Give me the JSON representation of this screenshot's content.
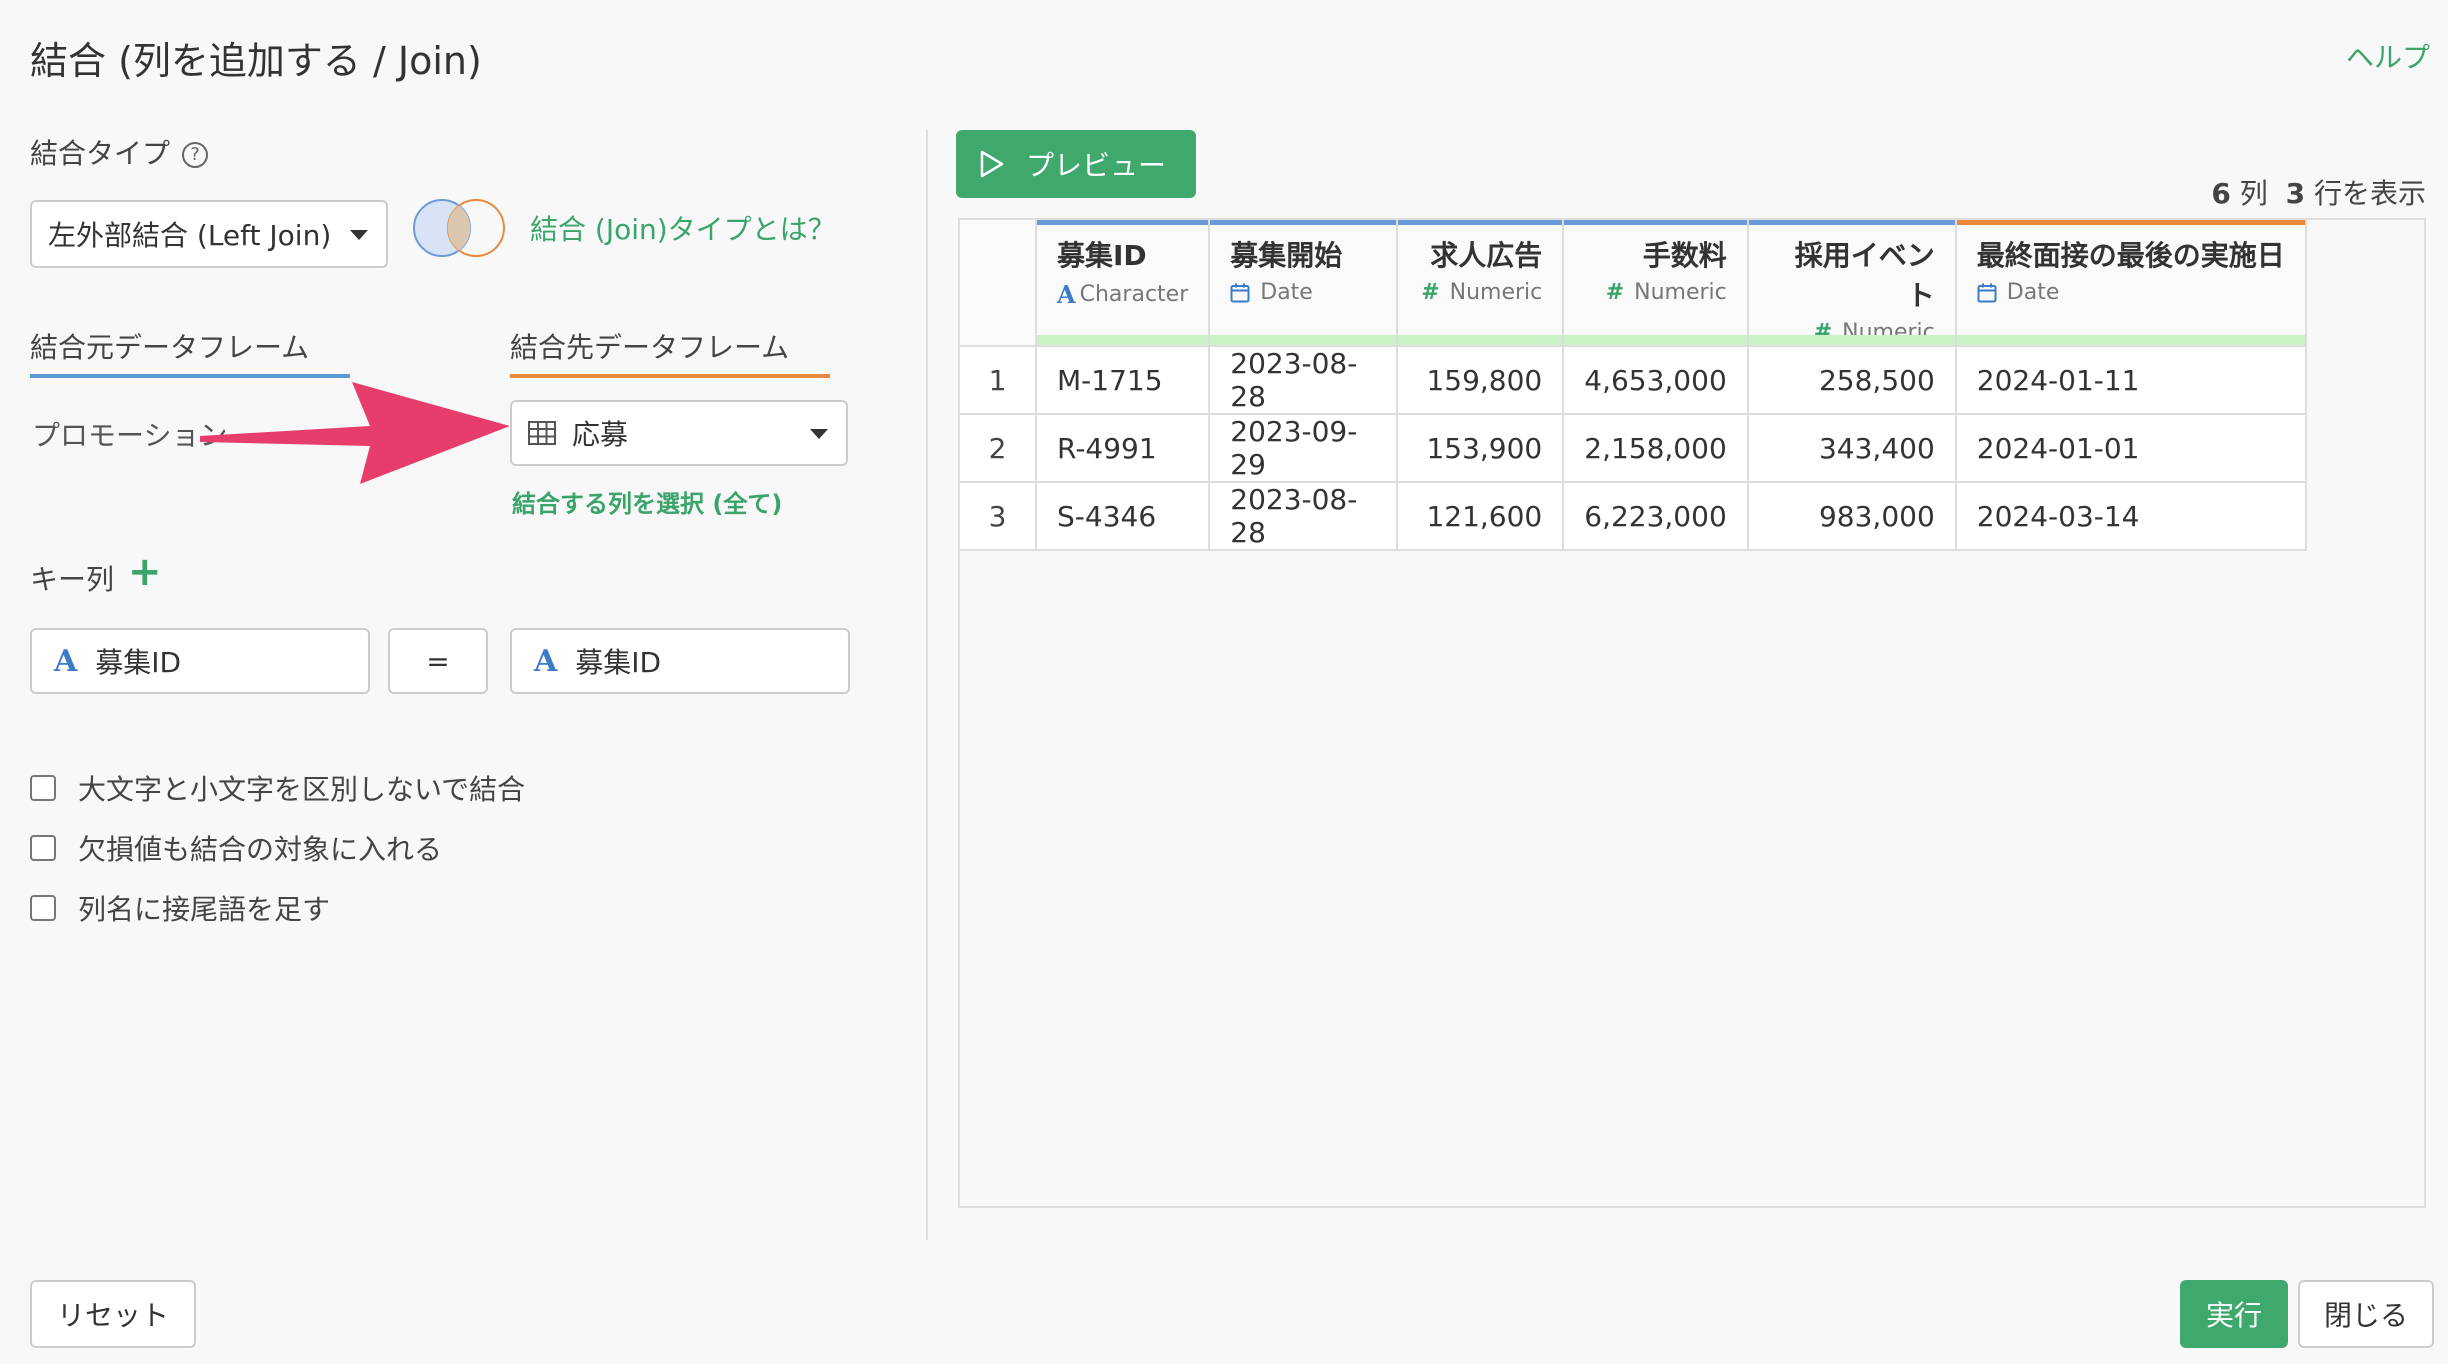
{
  "header": {
    "title": "結合 (列を追加する / Join)",
    "help_link": "ヘルプ"
  },
  "left_panel": {
    "join_type_label": "結合タイプ",
    "join_type_value": "左外部結合 (Left Join)",
    "join_type_help_link": "結合 (Join)タイプとは？",
    "source_tab": "結合元データフレーム",
    "target_tab": "結合先データフレーム",
    "source_name": "プロモーション",
    "target_value": "応募",
    "select_columns_link": "結合する列を選択 (全て)",
    "key_label": "キー列",
    "key_left": "募集ID",
    "key_operator": "=",
    "key_right": "募集ID",
    "options": [
      "大文字と小文字を区別しないで結合",
      "欠損値も結合の対象に入れる",
      "列名に接尾語を足す"
    ],
    "reset_button": "リセット",
    "colors": {
      "source_tab": "#5b9bd5",
      "target_tab": "#e8893b",
      "arrow": "#e63d6c",
      "accent": "#3fa86d"
    }
  },
  "right_panel": {
    "preview_button": "プレビュー",
    "count_cols": "6",
    "count_cols_unit": "列",
    "count_rows": "3",
    "count_rows_unit": "行を表示",
    "columns": [
      {
        "name": "募集ID",
        "type": "Character"
      },
      {
        "name": "募集開始",
        "type": "Date"
      },
      {
        "name": "求人広告",
        "type": "Numeric"
      },
      {
        "name": "手数料",
        "type": "Numeric"
      },
      {
        "name": "採用イベント",
        "type": "Numeric"
      },
      {
        "name": "最終面接の最後の実施日",
        "type": "Date"
      }
    ],
    "rows": [
      {
        "n": "1",
        "cells": [
          "M-1715",
          "2023-08-28",
          "159,800",
          "4,653,000",
          "258,500",
          "2024-01-11"
        ]
      },
      {
        "n": "2",
        "cells": [
          "R-4991",
          "2023-09-29",
          "153,900",
          "2,158,000",
          "343,400",
          "2024-01-01"
        ]
      },
      {
        "n": "3",
        "cells": [
          "S-4346",
          "2023-08-28",
          "121,600",
          "6,223,000",
          "983,000",
          "2024-03-14"
        ]
      }
    ],
    "run_button": "実行",
    "close_button": "閉じる"
  }
}
